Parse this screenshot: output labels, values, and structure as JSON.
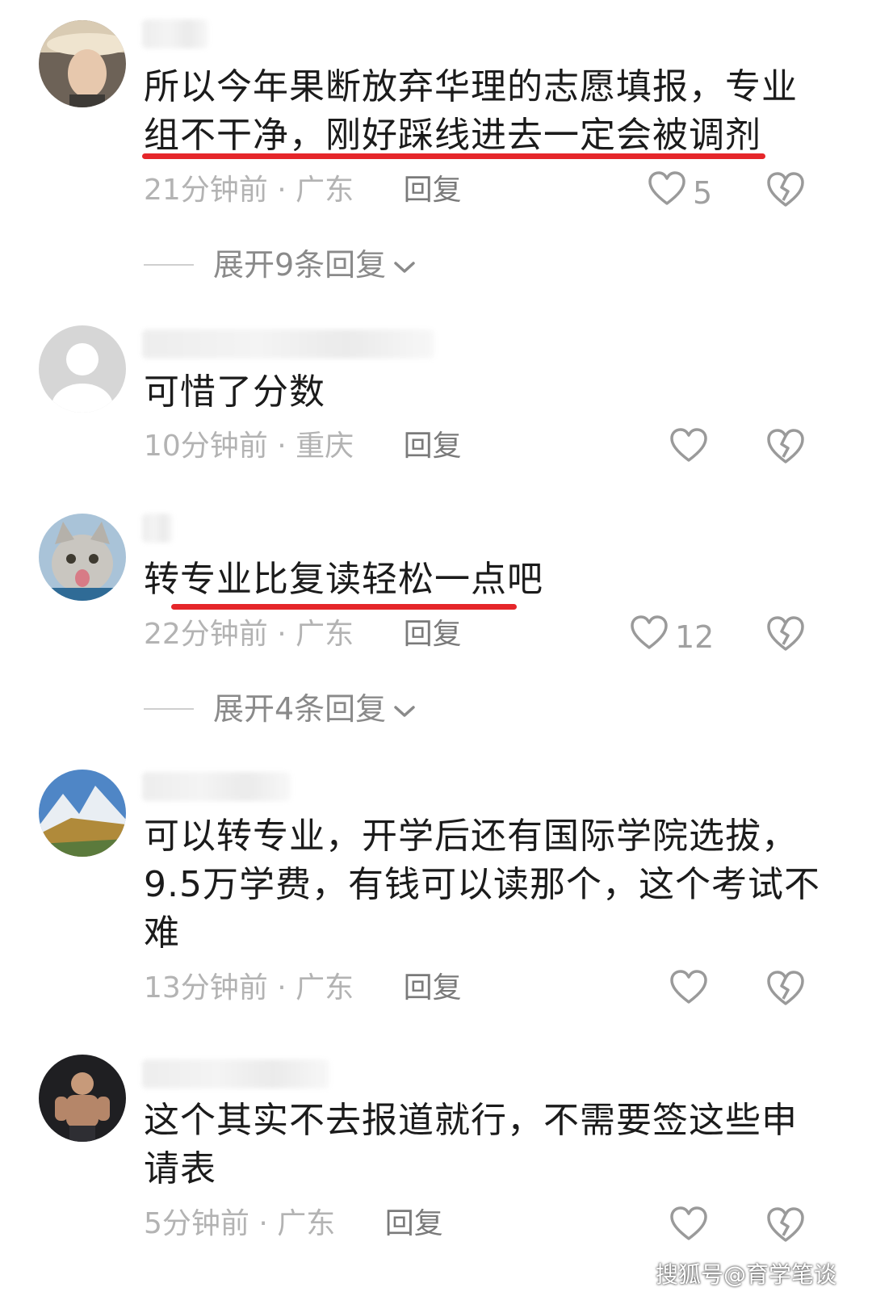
{
  "comments": [
    {
      "lines": [
        "所以今年果断放弃华理的志愿填报，专业",
        "组不干净，刚好踩线进去一定会被调剂"
      ],
      "time": "21分钟前",
      "location": "广东",
      "reply": "回复",
      "likes": "5",
      "expand": "展开9条回复"
    },
    {
      "lines": [
        "可惜了分数"
      ],
      "time": "10分钟前",
      "location": "重庆",
      "reply": "回复",
      "likes": ""
    },
    {
      "lines": [
        "转专业比复读轻松一点吧"
      ],
      "time": "22分钟前",
      "location": "广东",
      "reply": "回复",
      "likes": "12",
      "expand": "展开4条回复"
    },
    {
      "lines": [
        "可以转专业，开学后还有国际学院选拔，",
        "9.5万学费，有钱可以读那个，这个考试不",
        "难"
      ],
      "time": "13分钟前",
      "location": "广东",
      "reply": "回复",
      "likes": ""
    },
    {
      "lines": [
        "这个其实不去报道就行，不需要签这些申",
        "请表"
      ],
      "time": "5分钟前",
      "location": "广东",
      "reply": "回复",
      "likes": ""
    }
  ],
  "separator": "·",
  "highlight_color": "#e5262a",
  "icons": {
    "like": "heart-outline-icon",
    "dislike": "broken-heart-icon",
    "expand": "chevron-down-icon"
  },
  "watermark": "搜狐号@育学笔谈"
}
